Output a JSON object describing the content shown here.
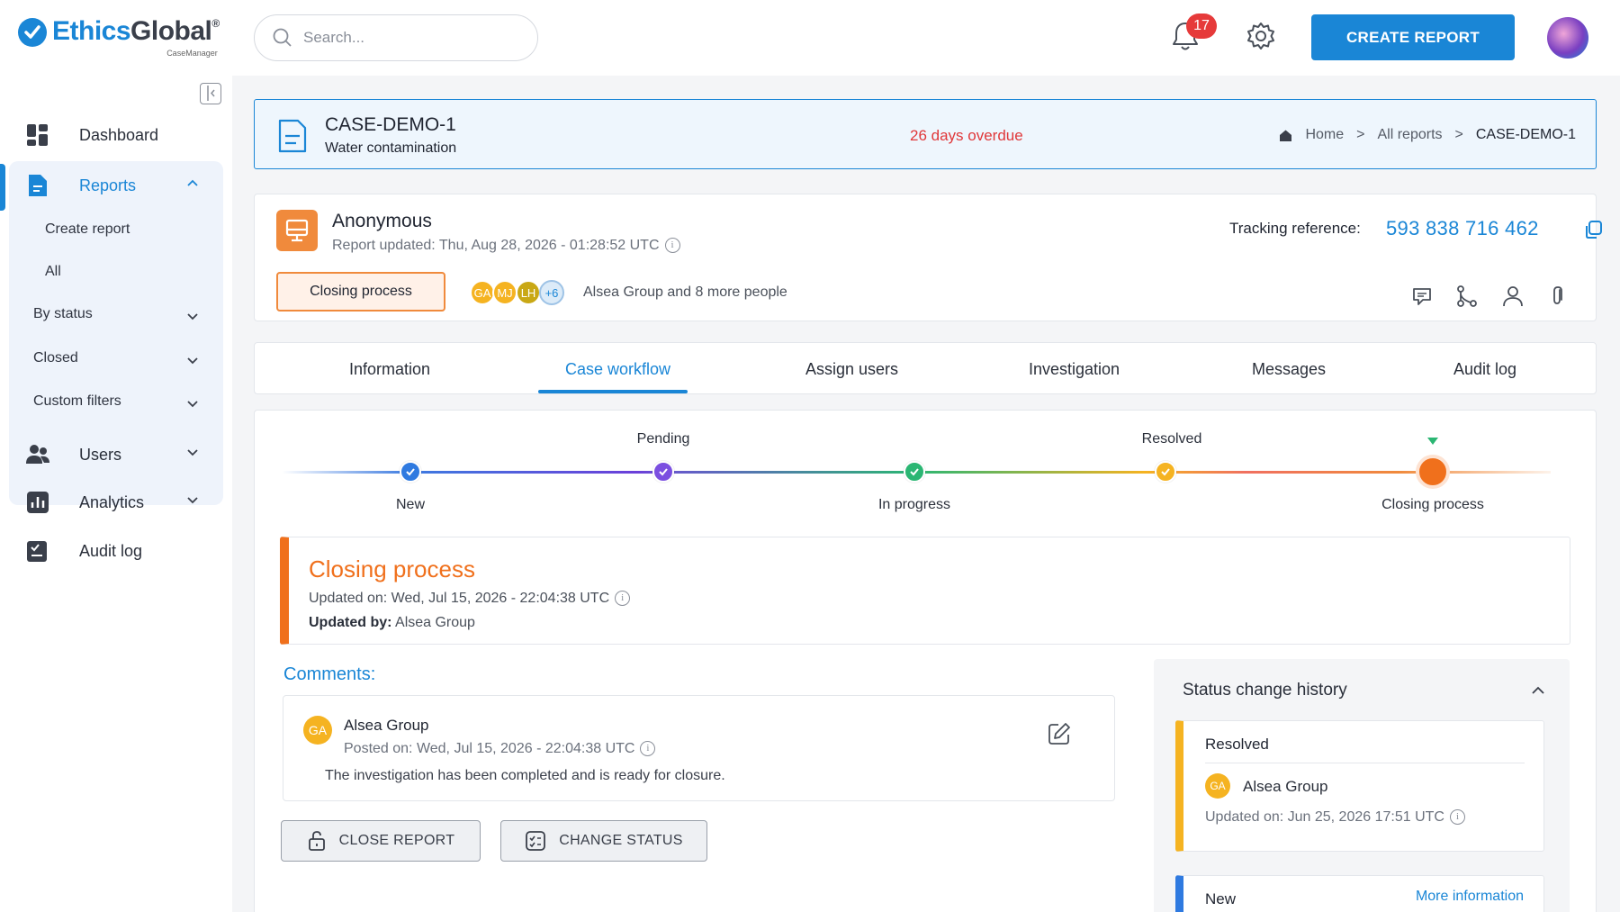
{
  "brand": {
    "name_part1": "Ethics",
    "name_part2": "Global",
    "reg": "®",
    "sub": "CaseManager",
    "color": "#1a86d6"
  },
  "topbar": {
    "search_placeholder": "Search...",
    "notifications_count": "17",
    "create_report_label": "CREATE REPORT"
  },
  "sidebar": {
    "dashboard": "Dashboard",
    "reports": "Reports",
    "create_report": "Create report",
    "all": "All",
    "by_status": "By status",
    "closed": "Closed",
    "custom_filters": "Custom filters",
    "users": "Users",
    "analytics": "Analytics",
    "audit_log": "Audit log"
  },
  "case": {
    "id": "CASE-DEMO-1",
    "subtitle": "Water contamination",
    "overdue": "26 days overdue",
    "breadcrumb": {
      "home": "Home",
      "sep": ">",
      "all_reports": "All reports",
      "current": "CASE-DEMO-1"
    }
  },
  "reporter": {
    "name": "Anonymous",
    "updated": "Report updated: Thu, Aug 28, 2026 - 01:28:52 UTC",
    "status": "Closing process",
    "avatars": [
      {
        "initials": "GA",
        "color": "#f5b321"
      },
      {
        "initials": "MJ",
        "color": "#f5b321"
      },
      {
        "initials": "LH",
        "color": "#c9a815"
      },
      {
        "initials": "+6",
        "color": "#9ec3e6"
      }
    ],
    "people": "Alsea Group and 8 more people",
    "tracking_label": "Tracking reference:",
    "tracking_number": "593 838 716 462"
  },
  "tabs": [
    "Information",
    "Case workflow",
    "Assign users",
    "Investigation",
    "Messages",
    "Audit log"
  ],
  "active_tab": "Case workflow",
  "workflow": {
    "steps": [
      {
        "label": "New",
        "position": "below",
        "color": "#2f7ae0"
      },
      {
        "label": "Pending",
        "position": "above",
        "color": "#7b4fe0"
      },
      {
        "label": "In progress",
        "position": "below",
        "color": "#2bb673"
      },
      {
        "label": "Resolved",
        "position": "above",
        "color": "#f5b321"
      },
      {
        "label": "Closing process",
        "position": "below",
        "color": "#f0701c"
      }
    ],
    "current": {
      "title": "Closing process",
      "updated": "Updated on: Wed, Jul 15, 2026 - 22:04:38 UTC",
      "updated_by_label": "Updated by:",
      "updated_by": "Alsea Group"
    }
  },
  "comments": {
    "title": "Comments:",
    "items": [
      {
        "initials": "GA",
        "author": "Alsea Group",
        "posted": "Posted on: Wed, Jul 15, 2026 - 22:04:38 UTC",
        "text": "The investigation has been completed and is ready for closure."
      }
    ]
  },
  "buttons": {
    "close_report": "CLOSE REPORT",
    "change_status": "CHANGE STATUS"
  },
  "history": {
    "title": "Status change history",
    "items": [
      {
        "status": "Resolved",
        "initials": "GA",
        "name": "Alsea Group",
        "updated": "Updated on: Jun 25, 2026 17:51 UTC",
        "color": "#f5b321"
      },
      {
        "status": "New",
        "more": "More information",
        "color": "#2f7ae0"
      }
    ]
  }
}
